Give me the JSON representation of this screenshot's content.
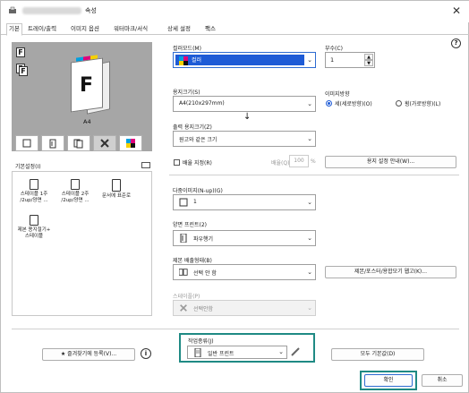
{
  "window": {
    "title": "속성",
    "close_glyph": "✕"
  },
  "tabs": [
    "기본",
    "트레이/출력",
    "이미지 옵션",
    "워터마크/서식",
    "상세 설정",
    "팩스"
  ],
  "preview": {
    "paper_label": "A4"
  },
  "view_buttons": [
    "paper-view-icon",
    "layout-view-icon",
    "duplex-view-icon",
    "tools-view-icon",
    "color-view-icon"
  ],
  "favorites": {
    "label": "기본설정(I)",
    "items": [
      {
        "line1": "스테이플 1주",
        "line2": "/2up/양면 ..."
      },
      {
        "line1": "스테이플 2주",
        "line2": "/2up/양면 ..."
      },
      {
        "line1": "문서에 표준로",
        "line2": ""
      },
      {
        "line1": "제본 용지절기+",
        "line2": "스테이플"
      }
    ]
  },
  "color_mode": {
    "label": "컬러모드(M)",
    "value": "컬러"
  },
  "copies": {
    "label": "부수(C)",
    "value": "1"
  },
  "help_glyph": "?",
  "paper_size": {
    "label": "용지크기(S)",
    "value": "A4(210x297mm)"
  },
  "orientation": {
    "label": "이미지방향",
    "options": [
      "세(세로방향)(O)",
      "횡(가로방향)(L)"
    ],
    "selected": 0
  },
  "output_size": {
    "label": "출력 용지크기(Z)",
    "value": "원고와 같은 크기"
  },
  "scale": {
    "checkbox_label": "배율 지정(R)",
    "sub_label": "배율(Q)",
    "value": "100",
    "unit": "%"
  },
  "paper_info_button": "용지 설정 안내(W)...",
  "nup": {
    "label": "다중이미지(N-up)(G)",
    "value": "1"
  },
  "duplex": {
    "label": "양면 프린트(2)",
    "value": "파우행기"
  },
  "finishing": {
    "label": "제본 배출형태(B)",
    "value": "선택 안 함"
  },
  "finishing_button": "제본/포스터/용합모기 웹고(K)...",
  "staple": {
    "label": "스테이플(P)",
    "value": "선택안함"
  },
  "job_type": {
    "label": "작업종류(J)",
    "value": "일반 프린트"
  },
  "bottom_buttons": {
    "add_favorite": "즐겨찾기에 등록(V)...",
    "restore_defaults": "모두 기본값(D)",
    "ok": "확인",
    "cancel": "취소"
  },
  "colors": {
    "highlight": "#1f8a84",
    "select_blue": "#1e5bd6",
    "preview_bg": "#a6a6a6"
  }
}
